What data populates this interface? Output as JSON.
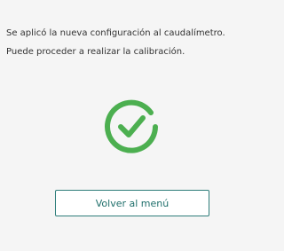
{
  "message": {
    "line1": "Se aplicó la nueva configuración al caudalímetro.",
    "line2": "Puede proceder a realizar la calibración."
  },
  "status": {
    "icon": "check-circle-icon",
    "color": "#4caf50"
  },
  "actions": {
    "back_label": "Volver al menú",
    "border_color": "#2e7d7a",
    "text_color": "#1f6f6b"
  }
}
